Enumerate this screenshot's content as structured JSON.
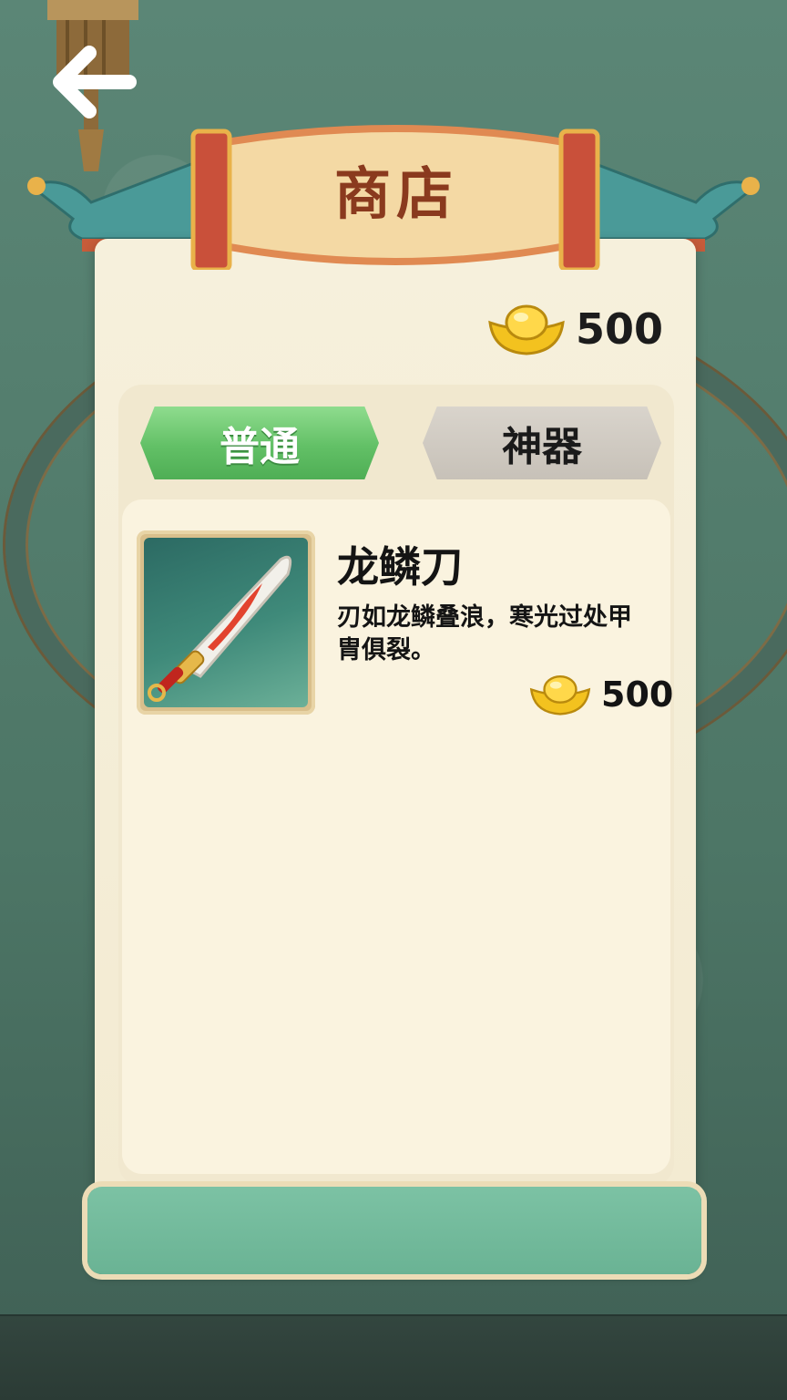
{
  "header": {
    "title": "商店"
  },
  "wallet": {
    "icon": "gold-ingot-icon",
    "amount": "500"
  },
  "tabs": [
    {
      "label": "普通",
      "active": true
    },
    {
      "label": "神器",
      "active": false
    }
  ],
  "items": [
    {
      "name": "龙鳞刀",
      "description": "刃如龙鳞叠浪，寒光过处甲胄俱裂。",
      "price": "500",
      "price_icon": "gold-ingot-icon",
      "image_icon": "dragon-scale-sword-icon"
    }
  ],
  "colors": {
    "accent_green": "#62c066",
    "title_red": "#8a3a1e",
    "panel_cream": "#f6f0dc",
    "background_teal": "#4f7a6a"
  }
}
